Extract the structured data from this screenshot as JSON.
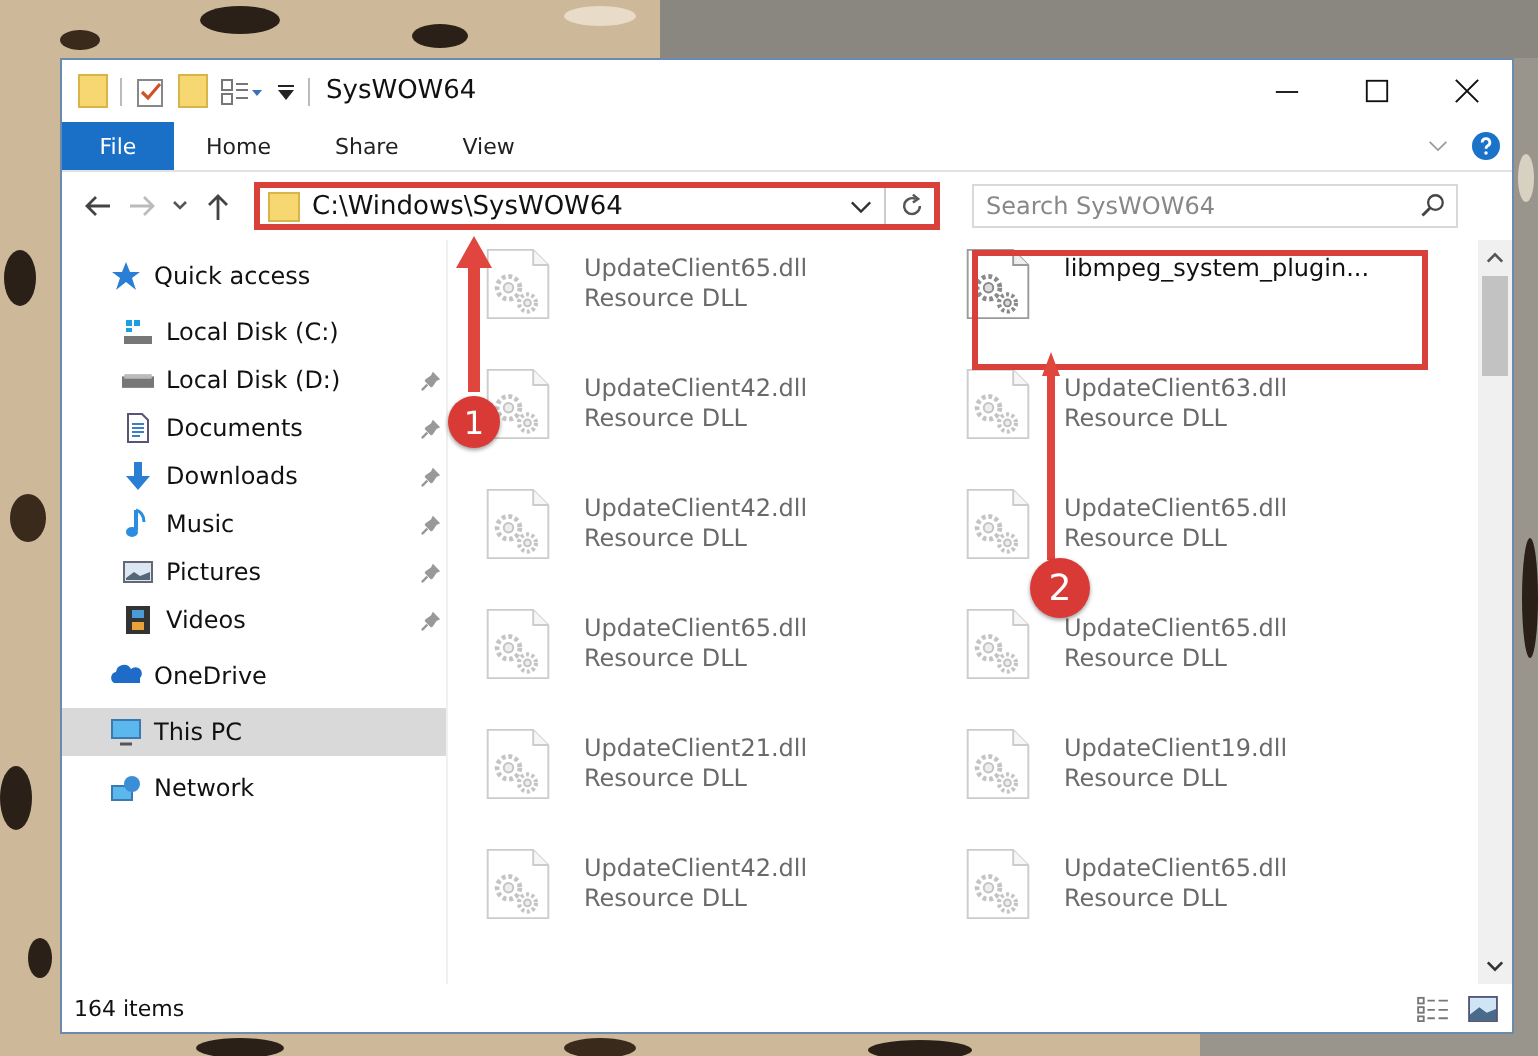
{
  "window": {
    "title": "SysWOW64"
  },
  "ribbon_tabs": [
    {
      "label": "File",
      "selected": true
    },
    {
      "label": "Home",
      "selected": false
    },
    {
      "label": "Share",
      "selected": false
    },
    {
      "label": "View",
      "selected": false
    }
  ],
  "address": {
    "value": "C:\\Windows\\SysWOW64"
  },
  "search": {
    "placeholder": "Search SysWOW64"
  },
  "sidebar": {
    "items": [
      {
        "label": "Quick access",
        "kind": "star",
        "selected": false,
        "children": [
          {
            "label": "Local Disk (C:)",
            "kind": "drive-c",
            "pinned": false
          },
          {
            "label": "Local Disk (D:)",
            "kind": "drive",
            "pinned": true
          },
          {
            "label": "Documents",
            "kind": "documents",
            "pinned": true
          },
          {
            "label": "Downloads",
            "kind": "downloads",
            "pinned": true
          },
          {
            "label": "Music",
            "kind": "music",
            "pinned": true
          },
          {
            "label": "Pictures",
            "kind": "pictures",
            "pinned": true
          },
          {
            "label": "Videos",
            "kind": "videos",
            "pinned": true
          }
        ]
      },
      {
        "label": "OneDrive",
        "kind": "onedrive",
        "selected": false
      },
      {
        "label": "This PC",
        "kind": "pc",
        "selected": true
      },
      {
        "label": "Network",
        "kind": "network",
        "selected": false
      }
    ]
  },
  "files": [
    {
      "name": "UpdateClient65.dll",
      "type": "Resource DLL",
      "blurred": true
    },
    {
      "name": "libmpeg_system_plugin...",
      "blurred": false
    },
    {
      "name": "UpdateClient42.dll",
      "type": "Resource DLL",
      "blurred": true
    },
    {
      "name": "UpdateClient63.dll",
      "type": "Resource DLL",
      "blurred": true
    },
    {
      "name": "UpdateClient42.dll",
      "type": "Resource DLL",
      "blurred": true
    },
    {
      "name": "UpdateClient65.dll",
      "type": "Resource DLL",
      "blurred": true
    },
    {
      "name": "UpdateClient65.dll",
      "type": "Resource DLL",
      "blurred": true
    },
    {
      "name": "UpdateClient65.dll",
      "type": "Resource DLL",
      "blurred": true
    },
    {
      "name": "UpdateClient21.dll",
      "type": "Resource DLL",
      "blurred": true
    },
    {
      "name": "UpdateClient19.dll",
      "type": "Resource DLL",
      "blurred": true
    },
    {
      "name": "UpdateClient42.dll",
      "type": "Resource DLL",
      "blurred": true
    },
    {
      "name": "UpdateClient65.dll",
      "type": "Resource DLL",
      "blurred": true
    }
  ],
  "status_bar": {
    "count": "164 items"
  },
  "annotations": [
    {
      "number": "1"
    },
    {
      "number": "2"
    }
  ]
}
